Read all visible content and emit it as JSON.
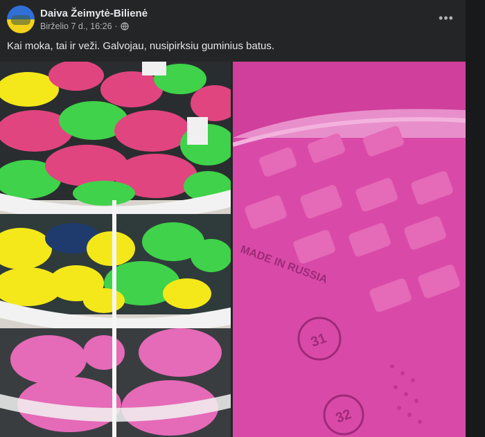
{
  "post": {
    "author": "Daiva Žeimytė-Bilienė",
    "timestamp": "Birželio 7 d., 16:26",
    "separator": "·",
    "privacy_icon": "globe-icon",
    "more_icon": "more-options-icon",
    "text": "Kai moka, tai ir veži. Galvojau, nusipirksiu guminius batus."
  },
  "photos": {
    "left": {
      "icon": "photo-shoe-display"
    },
    "right": {
      "icon": "photo-shoe-sole",
      "sole_text": "MADE IN RUSSIA",
      "size_a": "31",
      "size_b": "32"
    }
  },
  "colors": {
    "background": "#242526",
    "crocs_pink": "#e0457f",
    "crocs_green": "#3fd24a",
    "clog_yellow": "#f4e81a",
    "boot_pink": "#e56ab7",
    "sole_pink": "#d94aa8"
  }
}
